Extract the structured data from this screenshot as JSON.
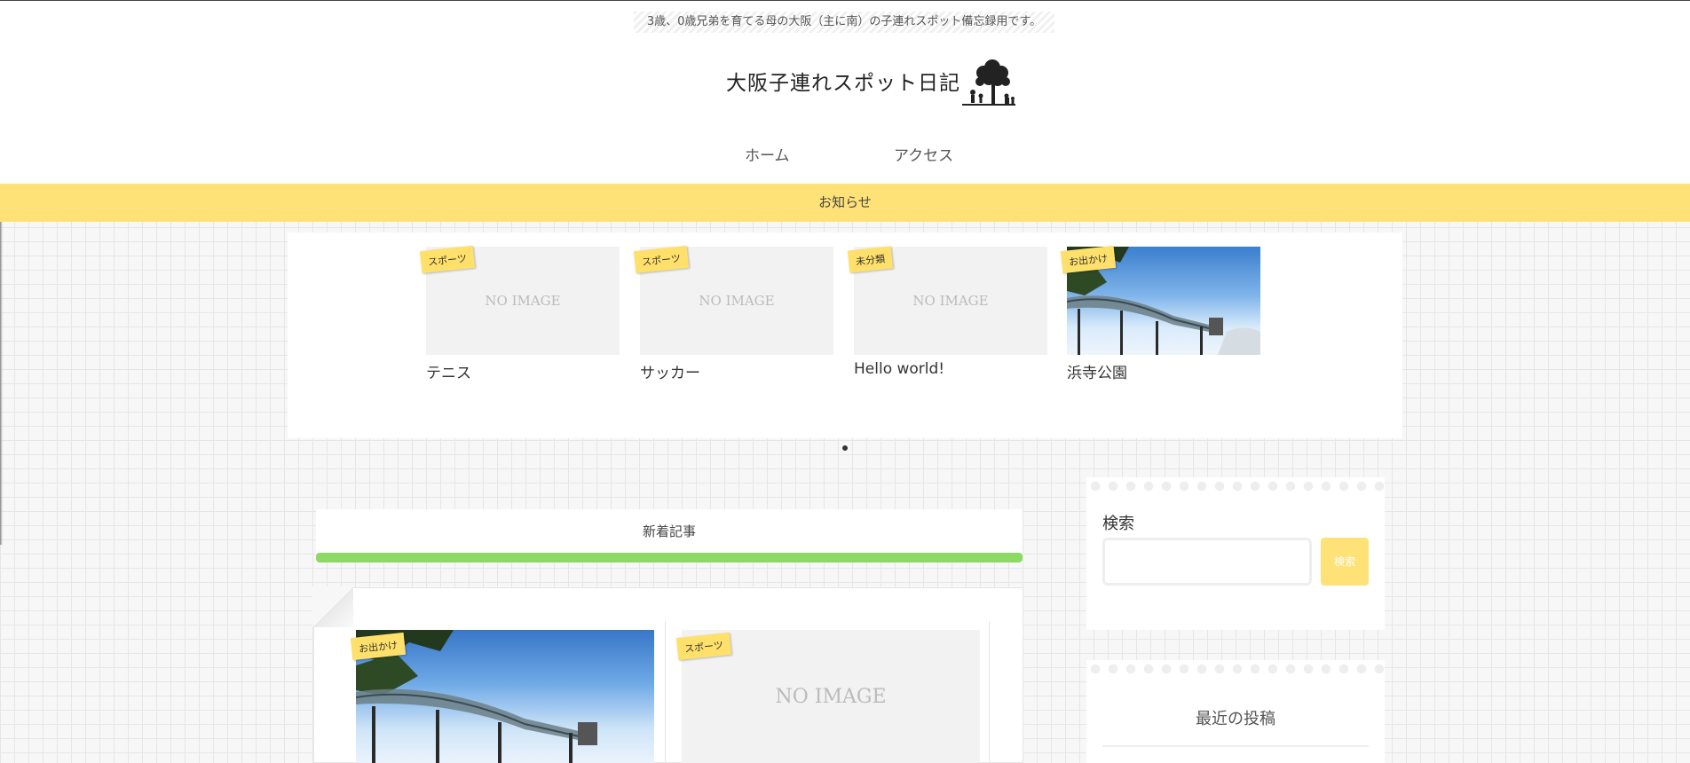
{
  "header": {
    "tagline": "3歳、0歳兄弟を育てる母の大阪（主に南）の子連れスポット備忘録用です。",
    "site_title": "大阪子連れスポット日記"
  },
  "nav": {
    "items": [
      {
        "label": "ホーム"
      },
      {
        "label": "アクセス"
      }
    ]
  },
  "notice": {
    "label": "お知らせ"
  },
  "slider": {
    "slides": [
      {
        "category": "スポーツ",
        "title": "テニス",
        "image_text": "NO IMAGE",
        "has_photo": false
      },
      {
        "category": "スポーツ",
        "title": "サッカー",
        "image_text": "NO IMAGE",
        "has_photo": false
      },
      {
        "category": "未分類",
        "title": "Hello world!",
        "image_text": "NO IMAGE",
        "has_photo": false
      },
      {
        "category": "お出かけ",
        "title": "浜寺公園",
        "image_text": "",
        "has_photo": true
      }
    ]
  },
  "main": {
    "section_title": "新着記事",
    "section_accent_color": "#8cd966",
    "posts": [
      {
        "category": "お出かけ",
        "image_text": "",
        "has_photo": true
      },
      {
        "category": "スポーツ",
        "image_text": "NO IMAGE",
        "has_photo": false
      }
    ]
  },
  "sidebar": {
    "search": {
      "title": "検索",
      "button_label": "検索",
      "placeholder": ""
    },
    "recent": {
      "title": "最近の投稿"
    }
  },
  "colors": {
    "accent_yellow": "#ffe277",
    "tag_yellow": "#ffe06a",
    "accent_green": "#8cd966"
  },
  "icons": {
    "logo": "tree-with-children-icon",
    "slider_pager": "dot-icon"
  }
}
